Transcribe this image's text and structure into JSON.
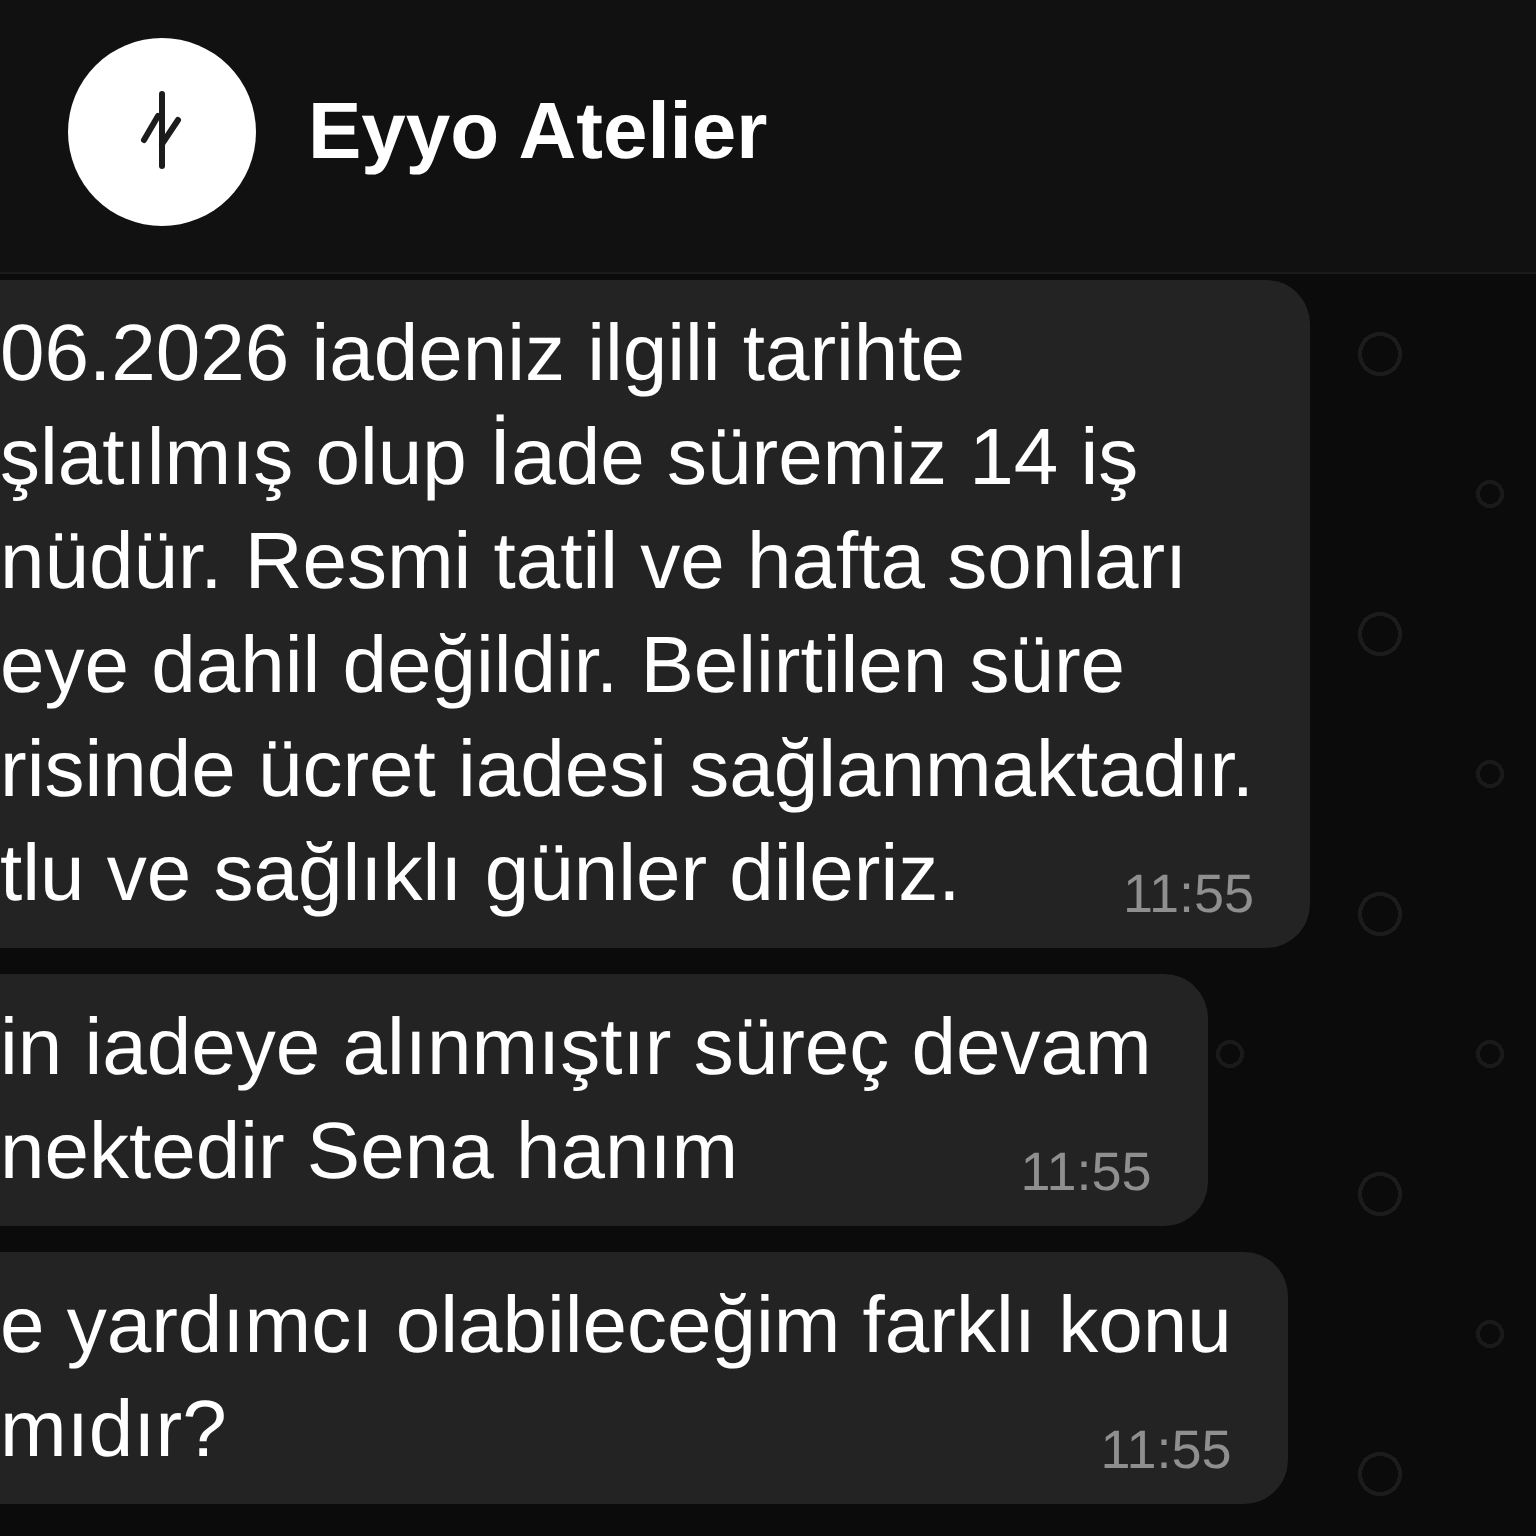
{
  "header": {
    "title": "Eyyo Atelier"
  },
  "messages": [
    {
      "lines": [
        "06.2026 iadeniz ilgili tarihte",
        "şlatılmış olup İade süremiz 14 iş",
        "nüdür. Resmi tatil ve hafta sonları",
        "eye dahil değildir. Belirtilen süre",
        "risinde ücret iadesi sağlanmaktadır.",
        "tlu ve sağlıklı günler dileriz."
      ],
      "time": "11:55"
    },
    {
      "lines": [
        "in iadeye alınmıştır süreç devam",
        "nektedir Sena hanım"
      ],
      "time": "11:55"
    },
    {
      "lines": [
        "e yardımcı olabileceğim farklı konu",
        "mıdır?"
      ],
      "time": "11:55"
    }
  ]
}
